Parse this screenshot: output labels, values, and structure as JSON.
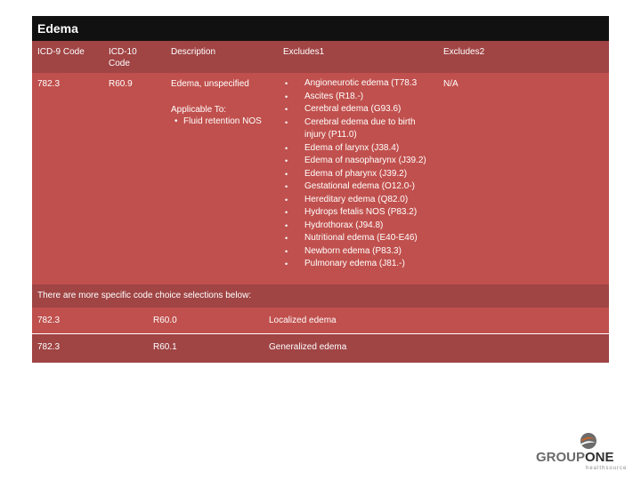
{
  "title": "Edema",
  "table": {
    "headers": {
      "icd9": "ICD-9 Code",
      "icd10": "ICD-10 Code",
      "description": "Description",
      "excludes1": "Excludes1",
      "excludes2": "Excludes2"
    },
    "main_row": {
      "icd9": "782.3",
      "icd10": "R60.9",
      "description": "Edema, unspecified",
      "applicable_label": "Applicable To:",
      "applicable_items": [
        "Fluid retention NOS"
      ],
      "excludes1": [
        "Angioneurotic edema (T78.3",
        "Ascites (R18.-)",
        "Cerebral edema (G93.6)",
        "Cerebral edema due to birth injury (P11.0)",
        "Edema of larynx (J38.4)",
        "Edema of nasopharynx (J39.2)",
        "Edema of pharynx (J39.2)",
        "Gestational edema (O12.0-)",
        "Hereditary edema (Q82.0)",
        "Hydrops fetalis NOS (P83.2)",
        "Hydrothorax (J94.8)",
        "Nutritional edema (E40-E46)",
        "Newborn edema (P83.3)",
        "Pulmonary edema (J81.-)"
      ],
      "excludes2": "N/A"
    },
    "note": "There are more specific code choice selections below:",
    "specific_rows": [
      {
        "icd9": "782.3",
        "icd10": "R60.0",
        "description": "Localized edema"
      },
      {
        "icd9": "782.3",
        "icd10": "R60.1",
        "description": "Generalized edema"
      }
    ]
  },
  "logo": {
    "word1": "GROUP",
    "word2": "ONE",
    "sub": "healthsource"
  },
  "colors": {
    "title_bg": "#111111",
    "row_dark": "#a04444",
    "row_light": "#c0504d"
  }
}
